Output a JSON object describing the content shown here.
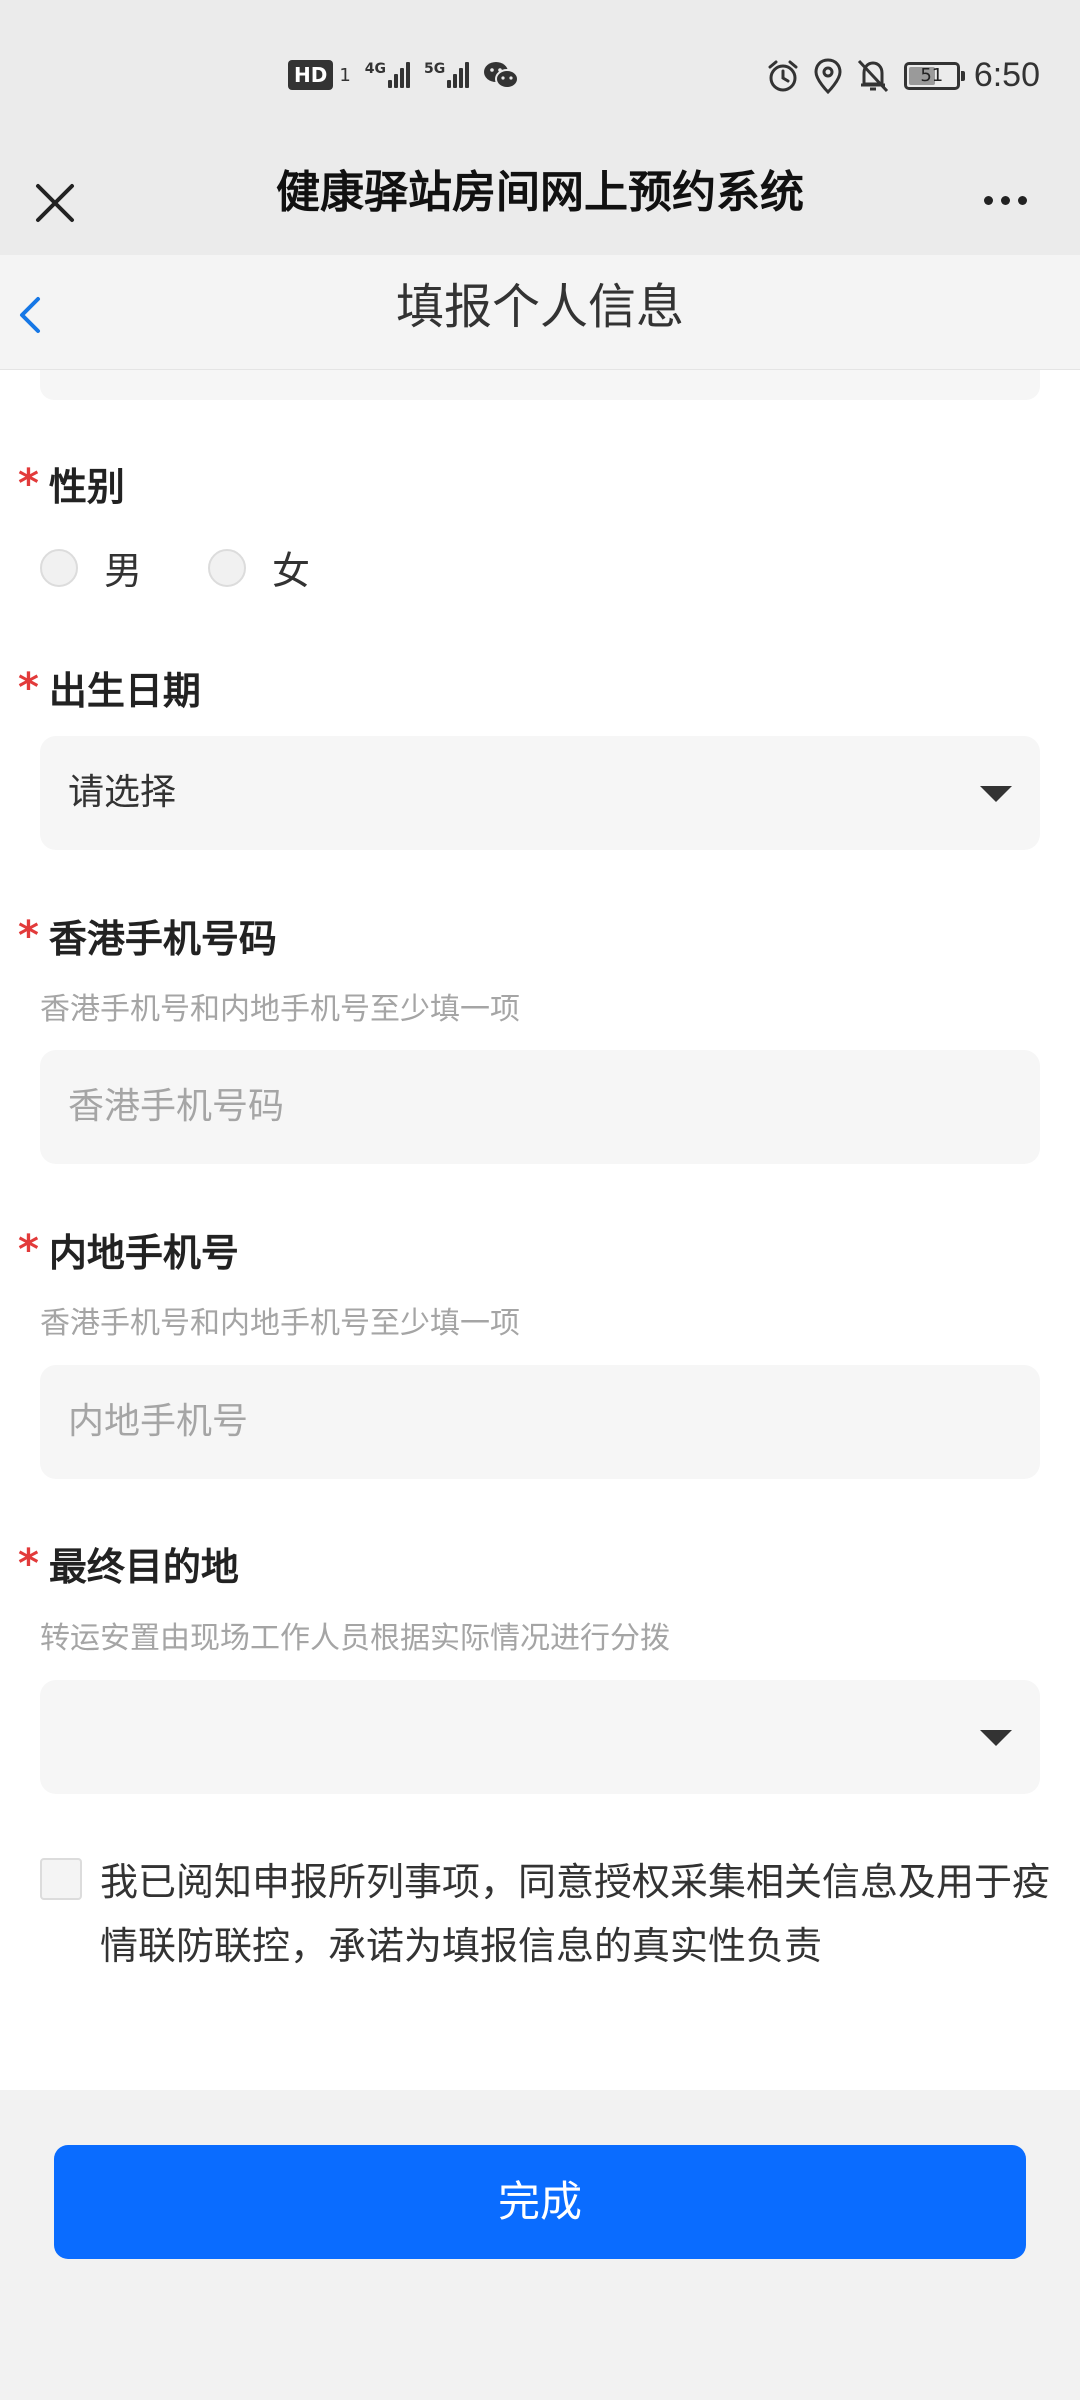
{
  "status_bar": {
    "hd_badge": "HD",
    "sim_num": "1",
    "net1": "4G",
    "net2": "5G",
    "battery_level": "51",
    "time": "6:50"
  },
  "title_bar": {
    "title": "健康驿站房间网上预约系统"
  },
  "nav": {
    "title": "填报个人信息"
  },
  "form": {
    "required_mark": "*",
    "gender": {
      "label": "性别",
      "options": [
        "男",
        "女"
      ]
    },
    "dob": {
      "label": "出生日期",
      "value": "请选择"
    },
    "hk_phone": {
      "label": "香港手机号码",
      "hint": "香港手机号和内地手机号至少填一项",
      "placeholder": "香港手机号码"
    },
    "mainland_phone": {
      "label": "内地手机号",
      "hint": "香港手机号和内地手机号至少填一项",
      "placeholder": "内地手机号"
    },
    "destination": {
      "label": "最终目的地",
      "hint": "转运安置由现场工作人员根据实际情况进行分拨",
      "value": ""
    },
    "agreement": "我已阅知申报所列事项，同意授权采集相关信息及用于疫情联防联控，承诺为填报信息的真实性负责"
  },
  "footer": {
    "done_label": "完成"
  },
  "colors": {
    "primary": "#0a6cff",
    "required": "#e23a3a"
  }
}
